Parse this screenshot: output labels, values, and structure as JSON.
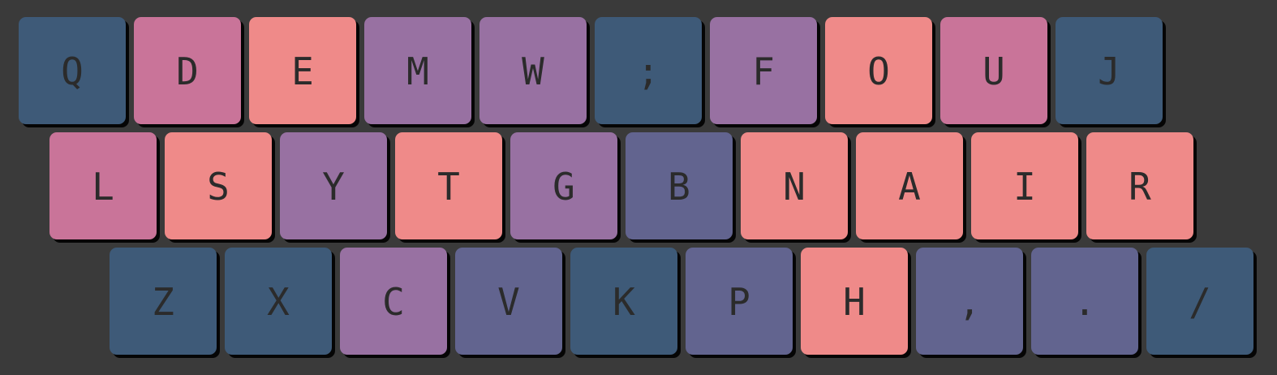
{
  "keyboard": {
    "colors": {
      "background": "#3a3a3a",
      "navy": "#3e5a78",
      "pink": "#c97499",
      "coral": "#ef8a89",
      "purple": "#9871a2",
      "indigo": "#62648f",
      "label": "#2b2b2b"
    },
    "rows": [
      {
        "keys": [
          {
            "label": "Q",
            "color": "navy"
          },
          {
            "label": "D",
            "color": "pink"
          },
          {
            "label": "E",
            "color": "coral"
          },
          {
            "label": "M",
            "color": "purple"
          },
          {
            "label": "W",
            "color": "purple"
          },
          {
            "label": ";",
            "color": "navy"
          },
          {
            "label": "F",
            "color": "purple"
          },
          {
            "label": "O",
            "color": "coral"
          },
          {
            "label": "U",
            "color": "pink"
          },
          {
            "label": "J",
            "color": "navy"
          }
        ]
      },
      {
        "keys": [
          {
            "label": "L",
            "color": "pink"
          },
          {
            "label": "S",
            "color": "coral"
          },
          {
            "label": "Y",
            "color": "purple"
          },
          {
            "label": "T",
            "color": "coral"
          },
          {
            "label": "G",
            "color": "purple"
          },
          {
            "label": "B",
            "color": "indigo"
          },
          {
            "label": "N",
            "color": "coral"
          },
          {
            "label": "A",
            "color": "coral"
          },
          {
            "label": "I",
            "color": "coral"
          },
          {
            "label": "R",
            "color": "coral"
          }
        ]
      },
      {
        "keys": [
          {
            "label": "Z",
            "color": "navy"
          },
          {
            "label": "X",
            "color": "navy"
          },
          {
            "label": "C",
            "color": "purple"
          },
          {
            "label": "V",
            "color": "indigo"
          },
          {
            "label": "K",
            "color": "navy"
          },
          {
            "label": "P",
            "color": "indigo"
          },
          {
            "label": "H",
            "color": "coral"
          },
          {
            "label": ",",
            "color": "indigo"
          },
          {
            "label": ".",
            "color": "indigo"
          },
          {
            "label": "/",
            "color": "navy"
          }
        ]
      }
    ]
  }
}
